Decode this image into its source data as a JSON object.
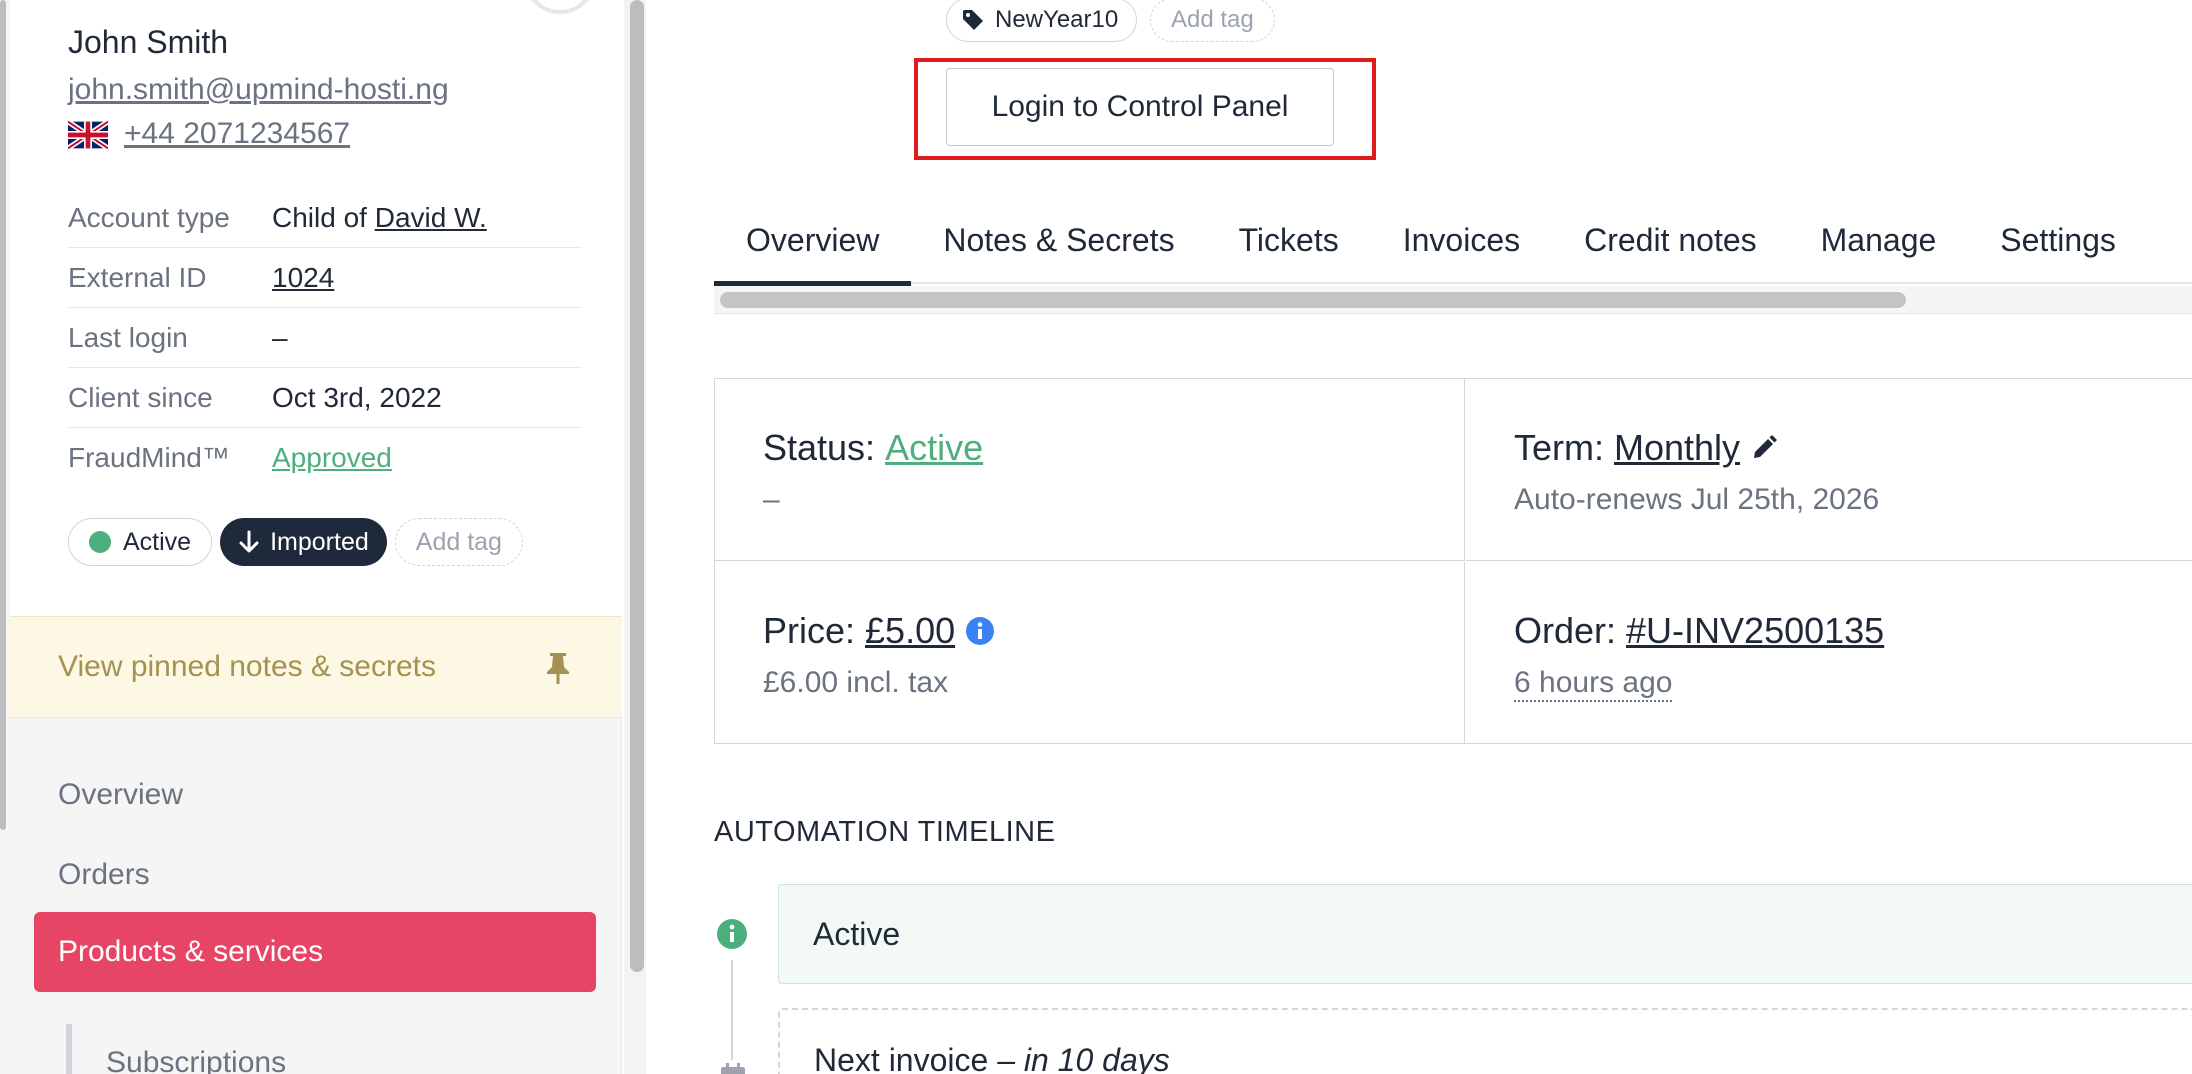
{
  "client": {
    "name": "John Smith",
    "email": "john.smith@upmind-hosti.ng",
    "phone": "+44 2071234567",
    "details": [
      {
        "label": "Account type",
        "prefix": "Child of ",
        "value": "David W."
      },
      {
        "label": "External ID",
        "value": "1024"
      },
      {
        "label": "Last login",
        "value": "–"
      },
      {
        "label": "Client since",
        "value": "Oct 3rd, 2022"
      },
      {
        "label": "FraudMind™",
        "value": "Approved"
      }
    ],
    "tags": {
      "active": "Active",
      "imported": "Imported",
      "add_tag": "Add tag"
    }
  },
  "pinned": {
    "label": "View pinned notes & secrets"
  },
  "sidebar_nav": {
    "overview": "Overview",
    "orders": "Orders",
    "products": "Products & services",
    "subscriptions": "Subscriptions"
  },
  "service": {
    "tag": "NewYear10",
    "add_tag": "Add tag",
    "login_button": "Login to Control Panel"
  },
  "tabs": [
    "Overview",
    "Notes & Secrets",
    "Tickets",
    "Invoices",
    "Credit notes",
    "Manage",
    "Settings"
  ],
  "summary": {
    "status_label": "Status:",
    "status_value": "Active",
    "status_sub": "–",
    "term_label": "Term:",
    "term_value": "Monthly",
    "term_sub": "Auto-renews Jul 25th, 2026",
    "price_label": "Price:",
    "price_value": "£5.00",
    "price_sub": "£6.00 incl. tax",
    "order_label": "Order:",
    "order_value": "#U-INV2500135",
    "order_sub": "6 hours ago"
  },
  "timeline": {
    "title": "AUTOMATION TIMELINE",
    "active": "Active",
    "next_invoice": "Next invoice",
    "next_sep": " – ",
    "next_when": "in 10 days"
  },
  "colors": {
    "accent": "#e64566",
    "success": "#4caf7d",
    "highlight": "#e01b1b"
  }
}
